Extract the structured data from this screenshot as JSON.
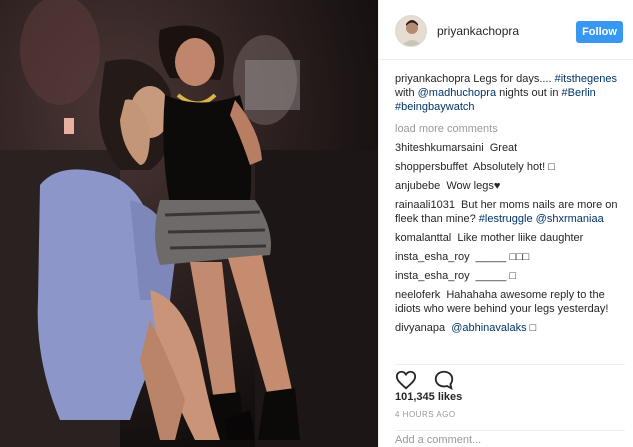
{
  "post": {
    "username": "priyankachopra",
    "follow_label": "Follow",
    "caption": {
      "user": "priyankachopra",
      "text_1": "Legs for days....",
      "hashtag_1": "#itsthegenes",
      "text_2": "with",
      "mention_1": "@madhuchopra",
      "text_3": "nights out in",
      "hashtag_2": "#Berlin",
      "hashtag_3": "#beingbaywatch"
    },
    "load_more": "load more comments",
    "comments": [
      {
        "user": "3hiteshkumarsaini",
        "text": "Great"
      },
      {
        "user": "shoppersbuffet",
        "text": "Absolutely hot! □"
      },
      {
        "user": "anjubebe",
        "text": "Wow legs♥"
      },
      {
        "user": "rainaali1031",
        "text": "But her moms nails are more on fleek than mine?",
        "tag": "#lestruggle",
        "mention": "@shxrmaniaa"
      },
      {
        "user": "komalanttal",
        "text": "Like mother liike daughter"
      },
      {
        "user": "insta_esha_roy",
        "text": "_____ □□□"
      },
      {
        "user": "insta_esha_roy",
        "text": "_____ □"
      },
      {
        "user": "neeloferk",
        "text": "Hahahaha awesome reply to the idiots who were behind your legs yesterday!"
      },
      {
        "user": "divyanapa",
        "mention": "@abhinavalaks",
        "text": "□"
      }
    ],
    "likes": "101,345 likes",
    "time": "4 HOURS AGO",
    "add_comment_placeholder": "Add a comment..."
  },
  "icons": {
    "like": "heart-icon",
    "comment": "comment-icon"
  },
  "colors": {
    "follow_button": "#3897f0",
    "link": "#003569",
    "muted": "#999999"
  }
}
